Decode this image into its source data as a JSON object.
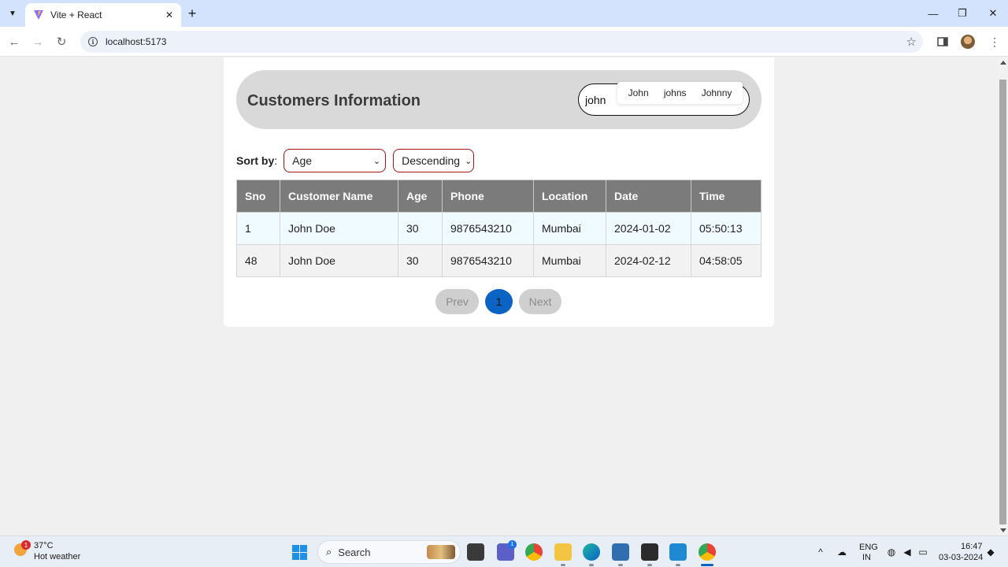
{
  "browser": {
    "tab_title": "Vite + React",
    "url": "localhost:5173"
  },
  "header": {
    "title": "Customers Information",
    "search_value": "john",
    "suggestions": [
      "John",
      "johns",
      "Johnny"
    ]
  },
  "sort": {
    "label": "Sort by",
    "field_value": "Age",
    "order_value": "Descending"
  },
  "table": {
    "columns": [
      "Sno",
      "Customer Name",
      "Age",
      "Phone",
      "Location",
      "Date",
      "Time"
    ],
    "rows": [
      [
        "1",
        "John Doe",
        "30",
        "9876543210",
        "Mumbai",
        "2024-01-02",
        "05:50:13"
      ],
      [
        "48",
        "John Doe",
        "30",
        "9876543210",
        "Mumbai",
        "2024-02-12",
        "04:58:05"
      ]
    ]
  },
  "pagination": {
    "prev_label": "Prev",
    "current_page": "1",
    "next_label": "Next"
  },
  "taskbar": {
    "weather_temp": "37°C",
    "weather_desc": "Hot weather",
    "weather_badge": "1",
    "search_label": "Search",
    "chat_badge": "1",
    "lang_top": "ENG",
    "lang_bottom": "IN",
    "time": "16:47",
    "date": "03-03-2024"
  },
  "colors": {
    "accent": "#0b63c4",
    "header_bg": "#d9d9d9",
    "table_header_bg": "#7b7b7b",
    "select_border": "#a31515",
    "tabstrip_bg": "#d3e3fd"
  }
}
